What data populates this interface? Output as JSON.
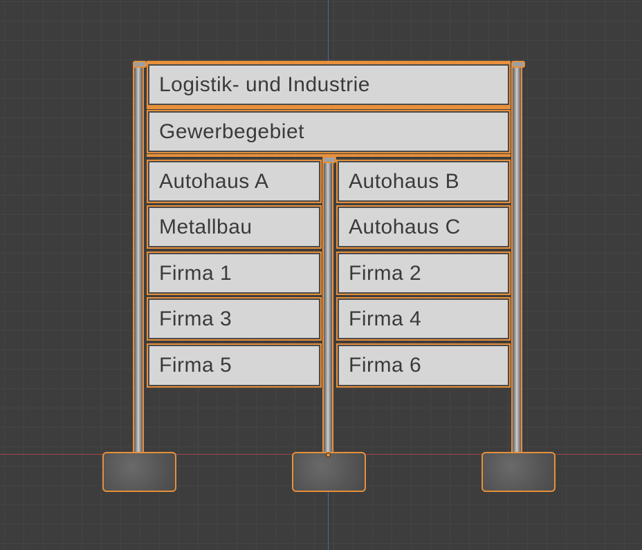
{
  "colors": {
    "background": "#3d3d3d",
    "grid_line": "#454545",
    "y_axis": "#4a6b9c",
    "x_axis": "#9a4848",
    "selection_outline": "#e8903a",
    "panel_face": "#d6d6d6",
    "panel_text": "#3a3a3a"
  },
  "sign": {
    "header_line1": "Logistik- und Industrie",
    "header_line2": "Gewerbegebiet",
    "left_panels": [
      "Autohaus A",
      "Metallbau",
      "Firma 1",
      "Firma 3",
      "Firma 5"
    ],
    "right_panels": [
      "Autohaus B",
      "Autohaus C",
      "Firma 2",
      "Firma 4",
      "Firma 6"
    ]
  }
}
